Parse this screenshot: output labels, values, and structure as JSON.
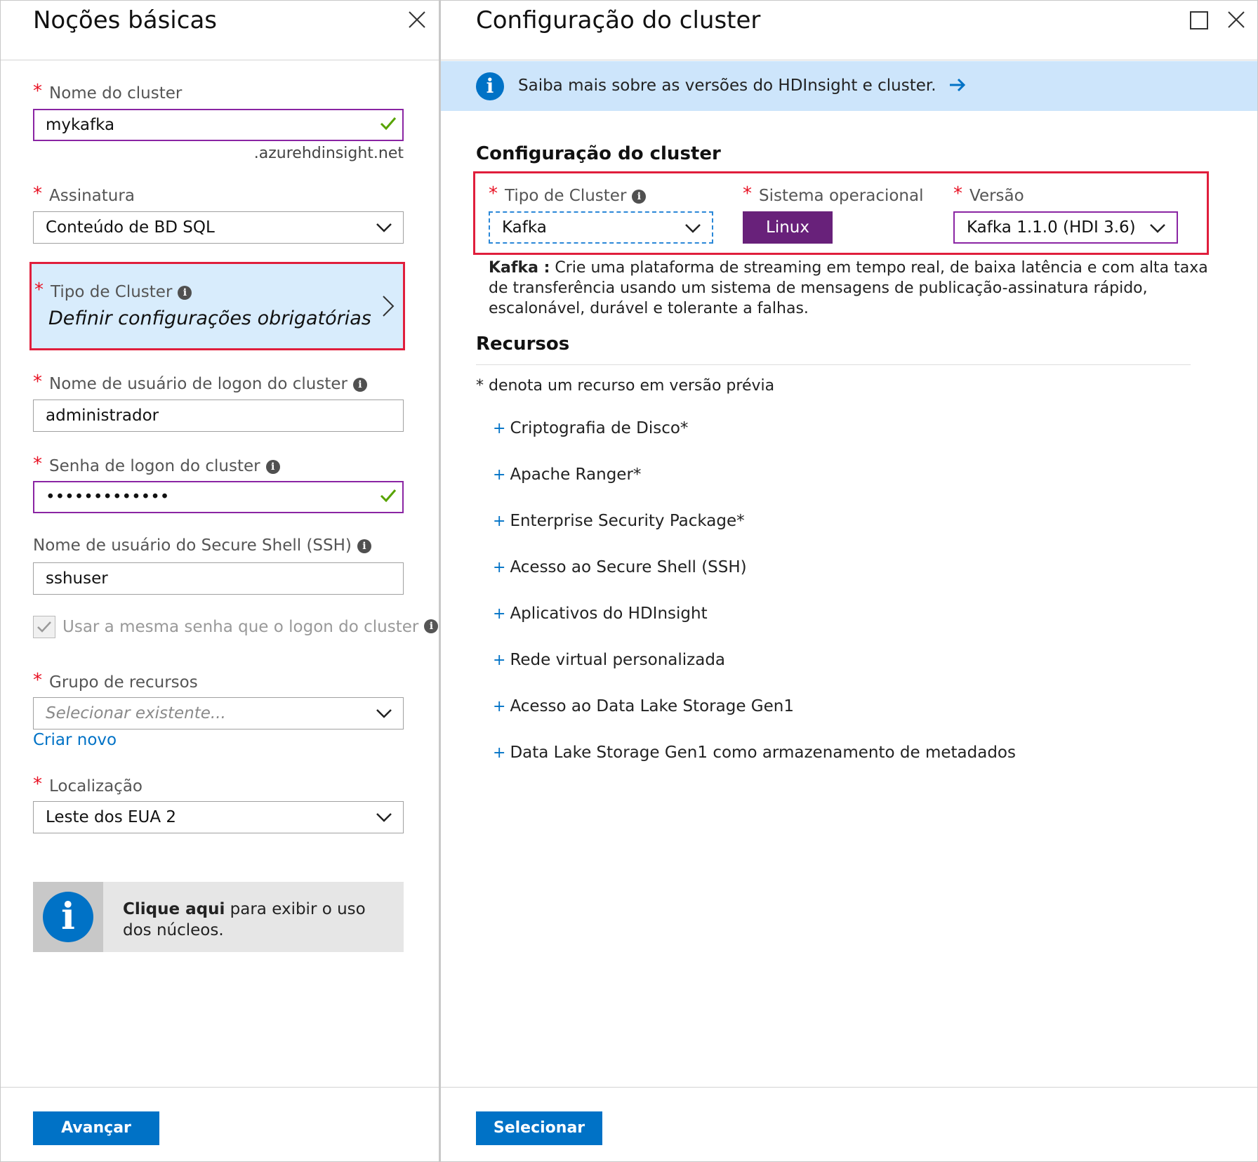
{
  "left_blade": {
    "title": "Noções básicas",
    "fields": {
      "cluster_name": {
        "label": "Nome do cluster",
        "value": "mykafka",
        "suffix": ".azurehdinsight.net"
      },
      "subscription": {
        "label": "Assinatura",
        "value": "Conteúdo de BD SQL"
      },
      "cluster_type": {
        "label": "Tipo de Cluster",
        "value": "Definir configurações obrigatórias"
      },
      "login_username": {
        "label": "Nome de usuário de logon do cluster",
        "value": "administrador"
      },
      "login_password": {
        "label": "Senha de logon do cluster",
        "value": "•••••••••••••"
      },
      "ssh_username": {
        "label": "Nome de usuário do Secure Shell (SSH)",
        "value": "sshuser"
      },
      "same_password": {
        "label": "Usar a mesma senha que o logon do cluster",
        "checked": true
      },
      "resource_group": {
        "label": "Grupo de recursos",
        "placeholder": "Selecionar existente...",
        "create_link": "Criar novo"
      },
      "location": {
        "label": "Localização",
        "value": "Leste dos EUA 2"
      }
    },
    "cores_info": {
      "bold": "Clique aqui",
      "rest": " para exibir o uso dos núcleos."
    },
    "next_button": "Avançar"
  },
  "right_blade": {
    "title": "Configuração do cluster",
    "banner": "Saiba mais sobre as versões do HDInsight e cluster.",
    "section_title": "Configuração do cluster",
    "cluster_type": {
      "label": "Tipo de Cluster",
      "value": "Kafka"
    },
    "os": {
      "label": "Sistema operacional",
      "value": "Linux"
    },
    "version": {
      "label": "Versão",
      "value": "Kafka 1.1.0 (HDI 3.6)"
    },
    "description": {
      "bold": "Kafka :",
      "text": " Crie uma plataforma de streaming em tempo real, de baixa latência e com alta taxa de transferência usando um sistema de mensagens de publicação-assinatura rápido, escalonável, durável e tolerante a falhas."
    },
    "resources_title": "Recursos",
    "preview_note": "* denota um recurso em versão prévia",
    "features": [
      "Criptografia de Disco*",
      "Apache Ranger*",
      "Enterprise Security Package*",
      "Acesso ao Secure Shell (SSH)",
      "Aplicativos do HDInsight",
      "Rede virtual personalizada",
      "Acesso ao Data Lake Storage Gen1",
      "Data Lake Storage Gen1 como armazenamento de metadados"
    ],
    "select_button": "Selecionar"
  },
  "symbols": {
    "required": "*",
    "info": "i",
    "plus": "+"
  },
  "colors": {
    "accent": "#0072c6",
    "highlight_frame": "#e01e3c",
    "valid_border": "#8a25a3",
    "os_button": "#68217a",
    "banner_bg": "#cde5fb"
  }
}
